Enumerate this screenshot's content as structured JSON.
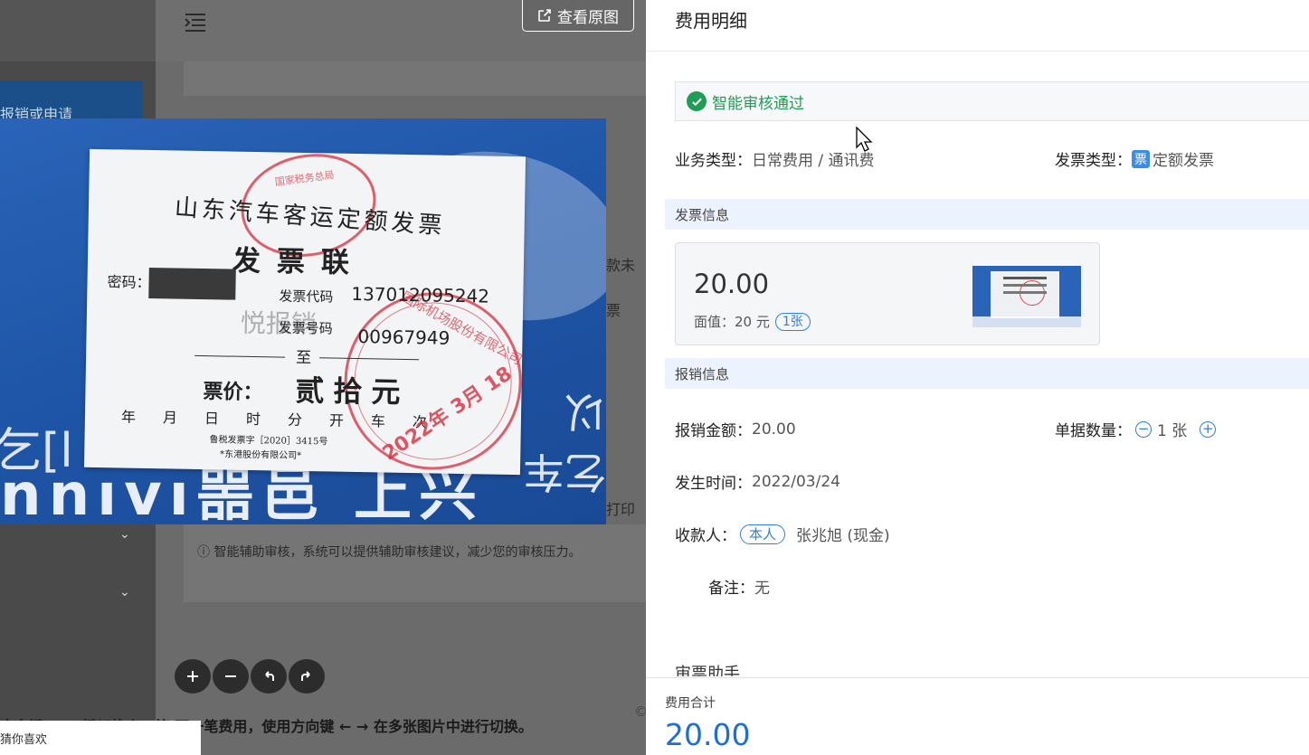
{
  "background": {
    "card_text": "报销或申请",
    "edge_text_1": "款未",
    "edge_text_2": "票",
    "edge_text_3": "打印",
    "tip": "ⓘ 智能辅助审核，系统可以提供辅助审核建议，减少您的审核压力。",
    "keyboard_hint": "方向键 ↑ ↓ 键切换上一笔/下一笔费用，使用方向键 ← → 在多张图片中进行切换。",
    "popup_text": "猜你喜欢"
  },
  "viewer": {
    "open_original_label": "查看原图",
    "tools": [
      "zoom-in",
      "zoom-out",
      "rotate-left",
      "rotate-right"
    ]
  },
  "ticket": {
    "title": "山东汽车客运定额发票",
    "subtitle": "发票联",
    "password_label": "密码：",
    "code_label": "发票代码",
    "code_value": "137012095242",
    "watermark": "悦报销",
    "number_label": "发票号码",
    "number_value": "00967949",
    "to": "至",
    "price_label": "票价：",
    "price_value": "贰拾元",
    "date_row": "年月日时分开车次",
    "footer_1": "鲁税发票字［2020］3415号",
    "footer_2": "*东港股份有限公司*",
    "stamp_text_1": "国家税务总局",
    "stamp_text_2": "2022年 3月 18",
    "stamp_text_3": "国际机场股份有限公司"
  },
  "drawer": {
    "title": "费用明细",
    "audit_status": "智能审核通过",
    "business_type_label": "业务类型：",
    "business_type_value": "日常费用 / 通讯费",
    "invoice_type_label": "发票类型：",
    "invoice_type_icon": "票",
    "invoice_type_value": "定额发票",
    "section_invoice": "发票信息",
    "invoice_amount": "20.00",
    "face_value": "面值：20 元",
    "face_count": "1张",
    "section_reimburse": "报销信息",
    "reimburse_amount_label": "报销金额：",
    "reimburse_amount_value": "20.00",
    "doc_count_label": "单据数量：",
    "doc_count_value": "1 张",
    "occur_time_label": "发生时间：",
    "occur_time_value": "2022/03/24",
    "payee_label": "收款人：",
    "payee_tag": "本人",
    "payee_value": "张兆旭 (现金)",
    "remark_label": "备注：",
    "remark_value": "无",
    "assistant_title": "审票助手",
    "total_label": "费用合计",
    "total_value": "20.00"
  },
  "colors": {
    "success": "#1f9d55",
    "accent": "#2f7fe0",
    "total": "#1b6fd6",
    "band": "#ecf3fe"
  }
}
